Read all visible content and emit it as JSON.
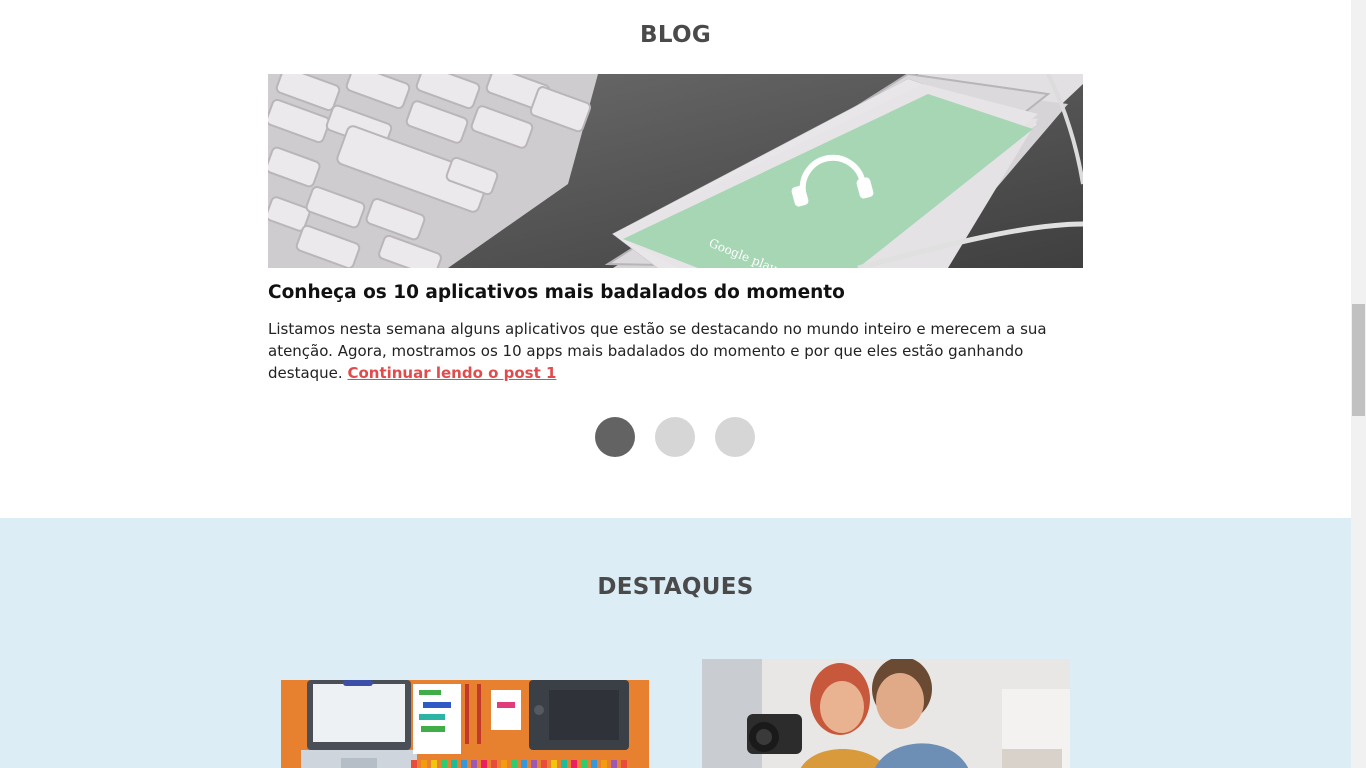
{
  "blog": {
    "title": "BLOG",
    "post": {
      "title": "Conheça os 10 aplicativos mais badalados do momento",
      "text": "Listamos nesta semana alguns aplicativos que estão se destacando no mundo inteiro e merecem a sua atenção. Agora, mostramos os 10 apps mais badalados do momento e por que eles estão ganhando destaque.",
      "link_label": "Continuar lendo o post 1",
      "image_caption": "Google play"
    },
    "slider": {
      "total": 3,
      "active": 1
    }
  },
  "highlights": {
    "title": "DESTAQUES"
  },
  "colors": {
    "accent_link": "#e24b4b",
    "highlights_bg": "#ddedf6",
    "heading": "#4a4a4a",
    "dot_active": "#636363",
    "dot_inactive": "#d6d6d6"
  }
}
